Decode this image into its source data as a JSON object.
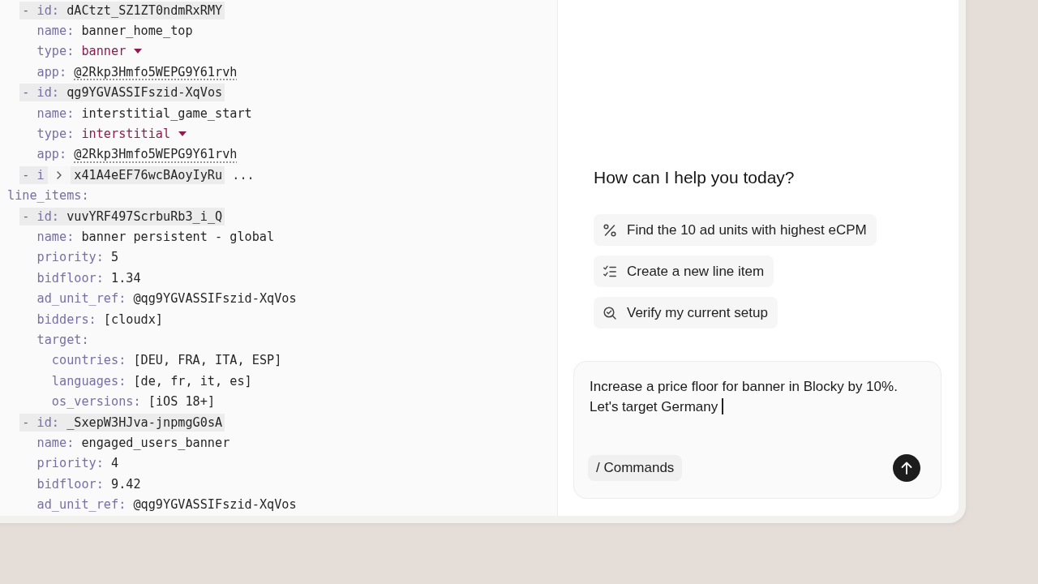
{
  "editor": {
    "sections": [
      {
        "children": [
          {
            "kind": "item",
            "bullet": "-",
            "key": "id:",
            "value": "dACtzt_SZ1ZT0ndmRxRMY",
            "children": [
              {
                "kind": "field",
                "key": "name:",
                "value": "banner_home_top"
              },
              {
                "kind": "enum",
                "key": "type:",
                "value": "banner"
              },
              {
                "kind": "ref",
                "key": "app:",
                "value": "@2Rkp3Hmfo5WEPG9Y61rvh"
              }
            ]
          },
          {
            "kind": "item",
            "bullet": "-",
            "key": "id:",
            "value": "qg9YGVASSIFszid-XqVos",
            "children": [
              {
                "kind": "field",
                "key": "name:",
                "value": "interstitial_game_start"
              },
              {
                "kind": "enum",
                "key": "type:",
                "value": "interstitial"
              },
              {
                "kind": "ref",
                "key": "app:",
                "value": "@2Rkp3Hmfo5WEPG9Y61rvh"
              }
            ]
          },
          {
            "kind": "collapsed",
            "bullet": "-",
            "key": "i",
            "value": "x41A4eEF76wcBAoyIyRu",
            "ellipsis": "..."
          }
        ]
      },
      {
        "key": "line_items:",
        "children": [
          {
            "kind": "item",
            "bullet": "-",
            "key": "id:",
            "value": "vuvYRF497ScrbuRb3_i_Q",
            "children": [
              {
                "kind": "field",
                "key": "name:",
                "value": "banner persistent - global"
              },
              {
                "kind": "field",
                "key": "priority:",
                "value": "5"
              },
              {
                "kind": "field",
                "key": "bidfloor:",
                "value": "1.34"
              },
              {
                "kind": "field",
                "key": "ad_unit_ref:",
                "value": "@qg9YGVASSIFszid-XqVos"
              },
              {
                "kind": "field",
                "key": "bidders:",
                "value": "[cloudx]"
              },
              {
                "kind": "map",
                "key": "target:",
                "children": [
                  {
                    "kind": "field",
                    "key": "countries:",
                    "value": "[DEU, FRA, ITA, ESP]"
                  },
                  {
                    "kind": "field",
                    "key": "languages:",
                    "value": "[de, fr, it, es]"
                  },
                  {
                    "kind": "field",
                    "key": "os_versions:",
                    "value": "[iOS 18+]"
                  }
                ]
              }
            ]
          },
          {
            "kind": "item",
            "bullet": "-",
            "key": "id:",
            "value": "_SxepW3HJva-jnpmgG0sA",
            "children": [
              {
                "kind": "field",
                "key": "name:",
                "value": "engaged_users_banner"
              },
              {
                "kind": "field",
                "key": "priority:",
                "value": "4"
              },
              {
                "kind": "field",
                "key": "bidfloor:",
                "value": "9.42"
              },
              {
                "kind": "field",
                "key": "ad_unit_ref:",
                "value": "@qg9YGVASSIFszid-XqVos"
              }
            ]
          }
        ]
      }
    ]
  },
  "assistant": {
    "greeting": "How can I help you today?",
    "suggestions": [
      {
        "kind": "metric",
        "label": "Find the 10 ad units with highest eCPM"
      },
      {
        "kind": "create",
        "label": "Create a new line item"
      },
      {
        "kind": "verify",
        "label": "Verify my current setup"
      }
    ],
    "composer": {
      "value": "Increase a price floor for banner in Blocky by 10%. Let's target Germany",
      "focused": true,
      "commands": "/ Commands"
    }
  }
}
